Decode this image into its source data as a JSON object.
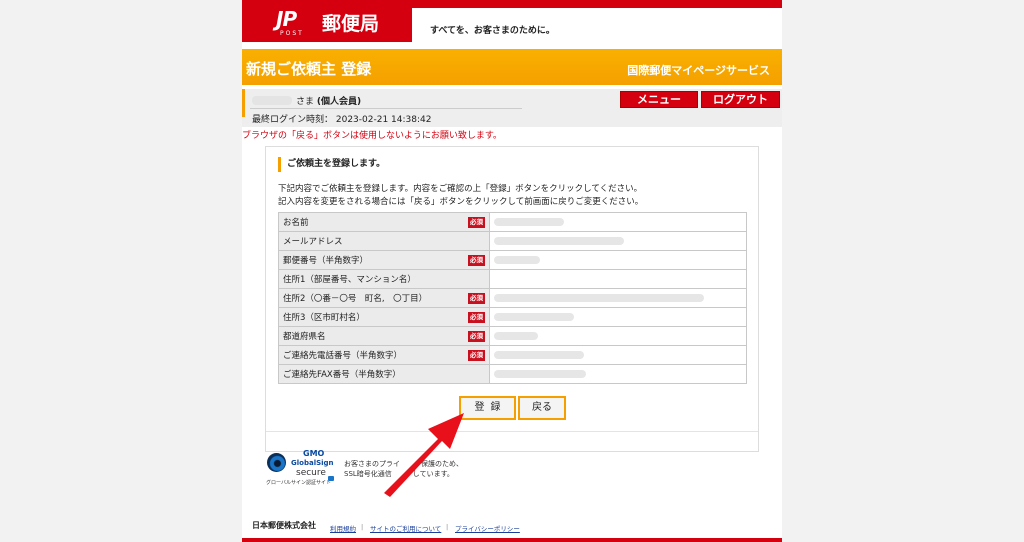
{
  "header": {
    "logo_mark": "JP",
    "logo_sub": "POST",
    "logo_text": "郵便局",
    "tagline": "すべてを、お客さまのために。"
  },
  "title_bar": {
    "title": "新規ご依頼主 登録",
    "service": "国際郵便マイページサービス"
  },
  "user": {
    "suffix": "さま",
    "member_type": "(個人会員)",
    "last_login": "最終ログイン時刻： 2023-02-21 14:38:42"
  },
  "nav": {
    "menu_label": "メニュー",
    "logout_label": "ログアウト"
  },
  "warning": "ブラウザの「戻る」ボタンは使用しないようにお願い致します。",
  "form": {
    "heading": "ご依頼主を登録します。",
    "desc1": "下記内容でご依頼主を登録します。内容をご確認の上「登録」ボタンをクリックしてください。",
    "desc2": "記入内容を変更をされる場合には「戻る」ボタンをクリックして前画面に戻りご変更ください。",
    "required_label": "必須",
    "rows": [
      {
        "label": "お名前",
        "required": true
      },
      {
        "label": "メールアドレス",
        "required": false
      },
      {
        "label": "郵便番号（半角数字）",
        "required": true
      },
      {
        "label": "住所1（部屋番号、マンション名）",
        "required": false
      },
      {
        "label": "住所2（〇番－〇号　町名,　〇丁目）",
        "required": true
      },
      {
        "label": "住所3（区市町村名）",
        "required": true
      },
      {
        "label": "都道府県名",
        "required": true
      },
      {
        "label": "ご連絡先電話番号（半角数字）",
        "required": true
      },
      {
        "label": "ご連絡先FAX番号（半角数字）",
        "required": false
      }
    ],
    "register_label": "登録",
    "back_label": "戻る"
  },
  "ssl": {
    "gmo": "GMO",
    "brand": "GlobalSign",
    "secure": "secure",
    "site_label": "グローバルサイン認証サイト",
    "text_line1": "お客さまのプライ　　　保護のため、",
    "text_line2": "SSL暗号化通信　　　しています。"
  },
  "footer": {
    "company": "日本郵便株式会社",
    "link1": "利用規約",
    "link2": "サイトのご利用について",
    "link3": "プライバシーポリシー",
    "separator": "|"
  },
  "colors": {
    "brand_red": "#d4000f",
    "accent_orange": "#f5a000",
    "pointer_red": "#e8101a"
  }
}
